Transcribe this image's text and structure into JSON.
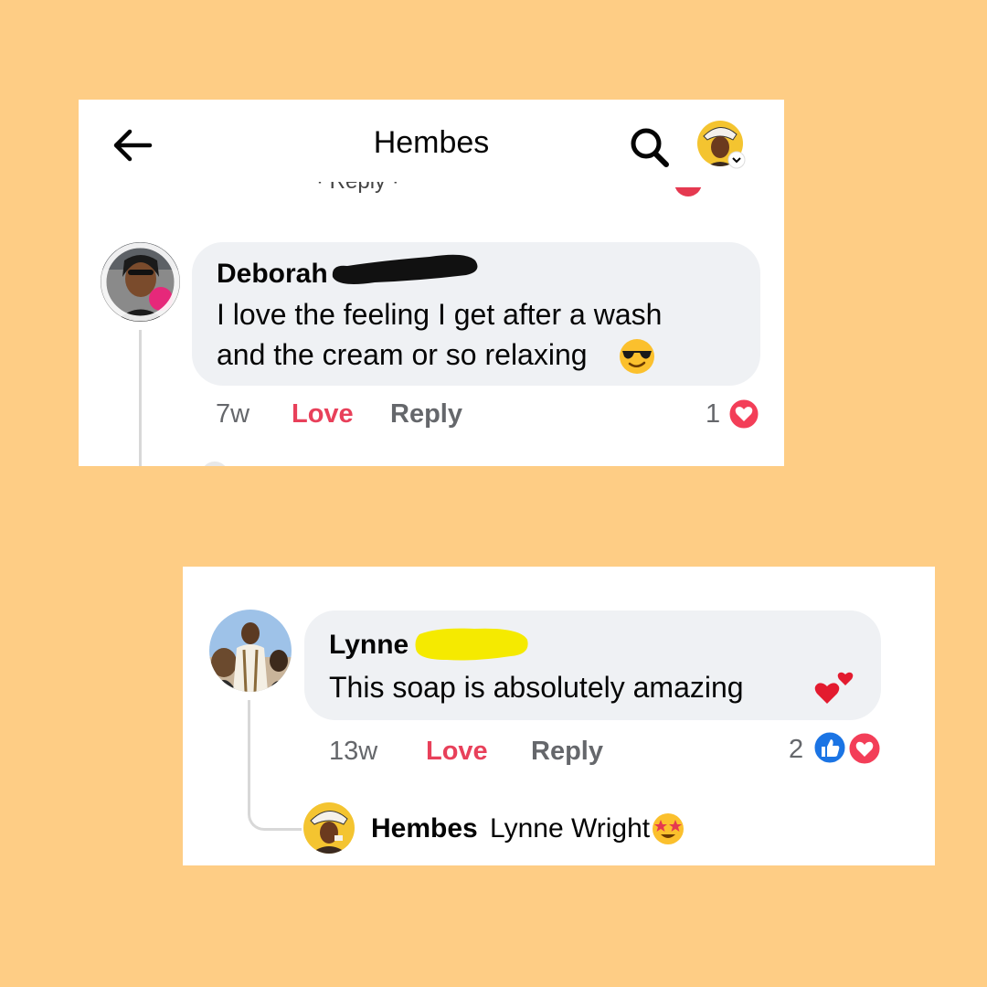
{
  "header": {
    "title": "Hembes",
    "back_icon": "arrow-left-icon",
    "search_icon": "search-icon",
    "partial_text": "· Reply ·"
  },
  "comments": [
    {
      "author": "Deborah",
      "text_line1": "I love the feeling I get after a wash",
      "text_line2": "and the cream or so relaxing",
      "emoji": "smiling-face-with-sunglasses",
      "time": "7w",
      "love_label": "Love",
      "reply_label": "Reply",
      "reaction_count": "1",
      "reactions": [
        "love"
      ]
    },
    {
      "author": "Lynne",
      "text": "This soap is absolutely amazing",
      "emoji": "two-hearts",
      "time": "13w",
      "love_label": "Love",
      "reply_label": "Reply",
      "reaction_count": "2",
      "reactions": [
        "like",
        "love"
      ],
      "reply": {
        "author": "Hembes",
        "mention": "Lynne Wright",
        "emoji": "star-struck"
      }
    }
  ],
  "colors": {
    "background": "#fecd85",
    "bubble": "#eff1f4",
    "love": "#e8405a",
    "like": "#1b74e4",
    "meta": "#65676b",
    "redact_black": "#111111",
    "redact_yellow": "#f5ea00"
  }
}
